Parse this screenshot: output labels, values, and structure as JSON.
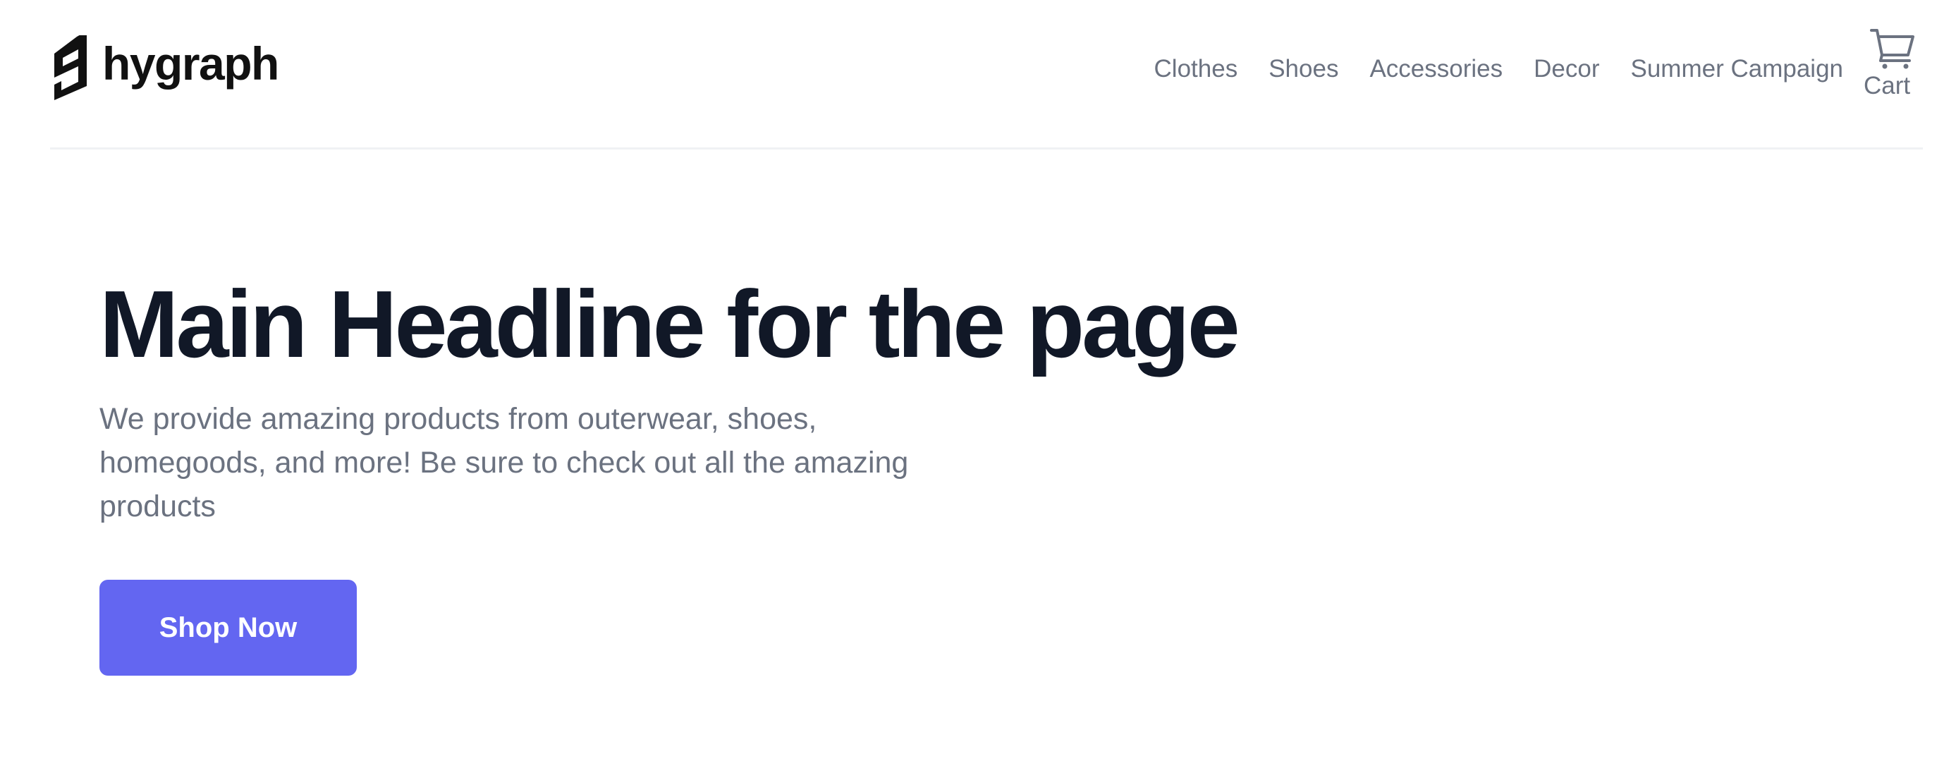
{
  "header": {
    "logo_text": "hygraph",
    "nav": [
      {
        "label": "Clothes"
      },
      {
        "label": "Shoes"
      },
      {
        "label": "Accessories"
      },
      {
        "label": "Decor"
      },
      {
        "label": "Summer Campaign"
      }
    ],
    "cart": {
      "label": "Cart",
      "icon": "shopping-cart-icon"
    }
  },
  "hero": {
    "headline": "Main Headline for the page",
    "subtext": "We provide amazing products from outerwear, shoes, homegoods, and more! Be sure to check out all the amazing products",
    "cta_label": "Shop Now"
  },
  "colors": {
    "accent": "#6366f1",
    "headline": "#111827",
    "muted_text": "#6b7280",
    "divider": "#f0f1f4"
  }
}
